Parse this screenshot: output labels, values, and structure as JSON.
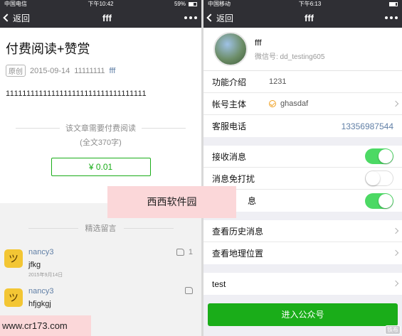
{
  "left": {
    "status": {
      "carrier": "中国电信",
      "time": "下午10:42",
      "battery": "59%",
      "battery_level": 0.59
    },
    "nav": {
      "back_label": "返回",
      "title": "fff"
    },
    "article": {
      "title": "付费阅读+赞赏",
      "original_tag": "原创",
      "date": "2015-09-14",
      "author": "11111111",
      "source": "fff",
      "body": "1111111111111111111111111111111111"
    },
    "paywall": {
      "notice": "该文章需要付费阅读",
      "word_count": "(全文370字)",
      "price_button": "¥ 0.01"
    },
    "comments": {
      "header": "精选留言",
      "items": [
        {
          "name": "nancy3",
          "text": "jfkg",
          "date": "2015年9月14日",
          "likes": "1"
        },
        {
          "name": "nancy3",
          "text": "hfjgkgj",
          "date": "",
          "likes": ""
        }
      ]
    }
  },
  "right": {
    "status": {
      "carrier": "中国移动",
      "time": "下午6:13"
    },
    "nav": {
      "back_label": "返回",
      "title": "fff"
    },
    "profile": {
      "name": "fff",
      "wechat_id": "微信号: dd_testing605"
    },
    "info_rows": [
      {
        "label": "功能介绍",
        "value": "1231"
      },
      {
        "label": "帐号主体",
        "value": "ghasdaf"
      },
      {
        "label": "客服电话",
        "value": "13356987544"
      }
    ],
    "toggle_rows": [
      {
        "label": "接收消息",
        "on": true
      },
      {
        "label": "消息免打扰",
        "on": false
      },
      {
        "label": "息",
        "on": true
      }
    ],
    "link_rows": [
      {
        "label": "查看历史消息"
      },
      {
        "label": "查看地理位置"
      }
    ],
    "extra_rows": [
      {
        "label": "test"
      }
    ],
    "enter_button": "进入公众号",
    "corner_mark": "铁布"
  },
  "overlays": {
    "watermark": "西西软件园",
    "site": "www.cr173.com"
  },
  "colors": {
    "bar": "#2f2f34",
    "green": "#1aad19",
    "toggle_on": "#4cd964",
    "link": "#607fa6",
    "overlay": "#fbd7d9"
  }
}
